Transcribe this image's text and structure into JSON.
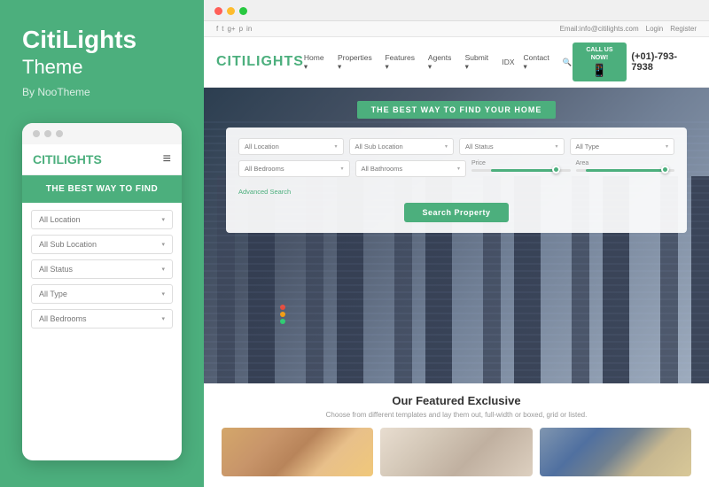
{
  "left": {
    "brand_name": "CitiLights",
    "brand_subtitle": "Theme",
    "brand_by": "By NooTheme",
    "mobile": {
      "dots": [
        "dot1",
        "dot2",
        "dot3"
      ],
      "logo_citi": "CITI",
      "logo_lights": "LIGHTS",
      "hamburger": "≡",
      "hero_text": "THE BEST WAY TO FIND",
      "fields": [
        {
          "label": "All Location",
          "arrow": "▾"
        },
        {
          "label": "All Sub Location",
          "arrow": "▾"
        },
        {
          "label": "All Status",
          "arrow": "▾"
        },
        {
          "label": "All Type",
          "arrow": "▾"
        },
        {
          "label": "All Bedrooms",
          "arrow": "▾"
        }
      ]
    }
  },
  "right": {
    "browser_dots": [
      "red",
      "yellow",
      "green"
    ],
    "utility_bar": {
      "social_icons": [
        "f",
        "t",
        "g+",
        "p",
        "in"
      ],
      "email": "Email:info@citilights.com",
      "login": "Login",
      "register": "Register"
    },
    "nav": {
      "logo_citi": "CITI",
      "logo_lights": "LIGHTS",
      "links": [
        {
          "label": "Home",
          "has_arrow": true
        },
        {
          "label": "Properties",
          "has_arrow": true
        },
        {
          "label": "Features",
          "has_arrow": true
        },
        {
          "label": "Agents",
          "has_arrow": true
        },
        {
          "label": "Submit",
          "has_arrow": true
        },
        {
          "label": "IDX"
        },
        {
          "label": "Contact",
          "has_arrow": true
        }
      ],
      "call_label": "CALL US NOW!",
      "phone": "(+01)-793-7938"
    },
    "hero": {
      "tagline": "THE BEST WAY TO FIND YOUR HOME",
      "search_button": "Search Property",
      "advanced_search": "Advanced Search",
      "fields_row1": [
        {
          "label": "All Location"
        },
        {
          "label": "All Sub Location"
        },
        {
          "label": "All Status"
        },
        {
          "label": "All Type"
        }
      ],
      "fields_row2": [
        {
          "label": "All Bedrooms"
        },
        {
          "label": "All Bathrooms"
        }
      ],
      "price_label": "Price",
      "area_label": "Area"
    },
    "featured": {
      "title": "Our Featured Exclusive",
      "subtitle": "Choose from different templates and lay them out, full-width or boxed, grid or listed.",
      "cards": [
        {
          "type": "interior"
        },
        {
          "type": "interior2"
        },
        {
          "type": "exterior"
        }
      ]
    }
  }
}
